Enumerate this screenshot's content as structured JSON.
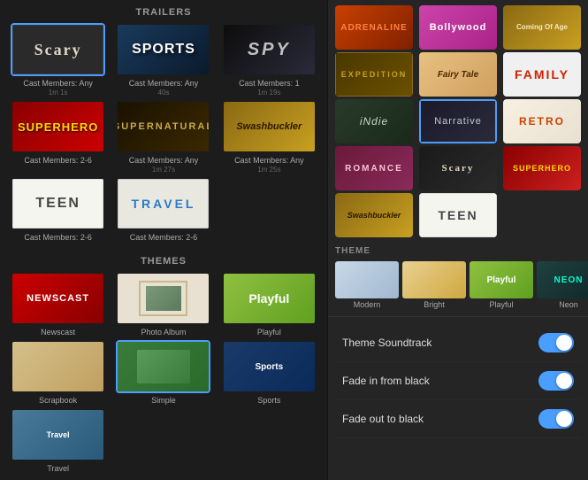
{
  "leftPanel": {
    "sections": [
      {
        "id": "trailers",
        "label": "TRAILERS",
        "items": [
          {
            "id": "scary",
            "label": "Scary",
            "sublabel": "Cast Members: Any\n1m 1s",
            "selected": false
          },
          {
            "id": "sports",
            "label": "Sports",
            "sublabel": "Cast Members: Any\n40s",
            "selected": false
          },
          {
            "id": "spy",
            "label": "Spy",
            "sublabel": "Cast Members: 1\n1m 19s",
            "selected": false
          },
          {
            "id": "superhero",
            "label": "Superhero",
            "sublabel": "Cast Members: 2-6\n",
            "selected": false
          },
          {
            "id": "supernatural",
            "label": "Supernatural",
            "sublabel": "Cast Members: Any\n1m 27s",
            "selected": false
          },
          {
            "id": "swashbuckler",
            "label": "Swashbuckler",
            "sublabel": "Cast Members: Any\n1m 25s",
            "selected": false
          },
          {
            "id": "teen",
            "label": "Teen",
            "sublabel": "Cast Members: 2-6\n",
            "selected": false
          },
          {
            "id": "travel",
            "label": "Travel",
            "sublabel": "Cast Members: 2-6\n",
            "selected": false
          }
        ]
      },
      {
        "id": "themes",
        "label": "THEMES",
        "items": [
          {
            "id": "newscast",
            "label": "Newscast",
            "selected": false
          },
          {
            "id": "photoalbum",
            "label": "Photo Album",
            "selected": false
          },
          {
            "id": "playful",
            "label": "Playful",
            "selected": false
          },
          {
            "id": "scrapbook",
            "label": "Scrapbook",
            "selected": false
          },
          {
            "id": "simple",
            "label": "Simple",
            "selected": true
          },
          {
            "id": "sports2",
            "label": "Sports",
            "selected": false
          },
          {
            "id": "travel2",
            "label": "Travel",
            "selected": false
          }
        ]
      }
    ]
  },
  "rightPanel": {
    "trailers": [
      {
        "id": "adrenaline",
        "label": "Adrenaline"
      },
      {
        "id": "bollywood",
        "label": "Bollywood"
      },
      {
        "id": "comingofage",
        "label": "Coming Of Age"
      },
      {
        "id": "expedition",
        "label": "Expedition"
      },
      {
        "id": "fairytale",
        "label": "Fairy Tale"
      },
      {
        "id": "family",
        "label": "Family"
      },
      {
        "id": "indie",
        "label": "iNdie"
      },
      {
        "id": "narrative",
        "label": "Narrative"
      },
      {
        "id": "retro",
        "label": "Retro"
      },
      {
        "id": "romance",
        "label": "Romance"
      },
      {
        "id": "scary",
        "label": "Scary"
      },
      {
        "id": "superhero",
        "label": "Superhero"
      },
      {
        "id": "swashbuckler",
        "label": "Swashbuckler"
      },
      {
        "id": "teen",
        "label": "Teen"
      }
    ],
    "themeSection": {
      "label": "THEME",
      "items": [
        {
          "id": "modern",
          "label": "Modern"
        },
        {
          "id": "bright",
          "label": "Bright"
        },
        {
          "id": "playful",
          "label": "Playful"
        },
        {
          "id": "neon",
          "label": "Neon"
        }
      ]
    },
    "settings": [
      {
        "id": "soundtrack",
        "label": "Theme Soundtrack",
        "enabled": true
      },
      {
        "id": "fadein",
        "label": "Fade in from black",
        "enabled": true
      },
      {
        "id": "fadeout",
        "label": "Fade out to black",
        "enabled": true
      }
    ]
  }
}
